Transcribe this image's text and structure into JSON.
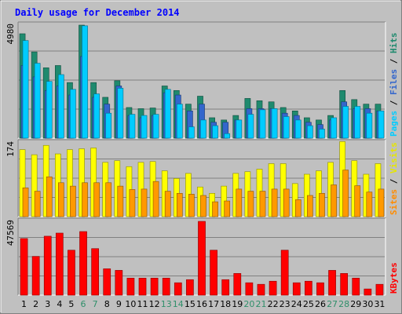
{
  "chart_data": {
    "type": "bar",
    "title": "Daily usage for December 2014",
    "categories": [
      "1",
      "2",
      "3",
      "4",
      "5",
      "6",
      "7",
      "8",
      "9",
      "10",
      "11",
      "12",
      "13",
      "14",
      "15",
      "16",
      "17",
      "18",
      "19",
      "20",
      "21",
      "22",
      "23",
      "24",
      "25",
      "26",
      "27",
      "28",
      "29",
      "30",
      "31"
    ],
    "weekend_days": [
      "6",
      "7",
      "13",
      "14",
      "20",
      "21",
      "27",
      "28"
    ],
    "panels": [
      {
        "ymax_label": "4980",
        "ymax": 4980,
        "legend": [
          {
            "text": "Pages",
            "color": "#00ccff"
          },
          {
            "text": " / ",
            "color": "#000000"
          },
          {
            "text": "Files",
            "color": "#3366cc"
          },
          {
            "text": " / ",
            "color": "#000000"
          },
          {
            "text": "Hits",
            "color": "#1f8a6e"
          }
        ],
        "series": [
          {
            "name": "Hits",
            "color": "#1f8a6e",
            "values": [
              4600,
              3800,
              3100,
              3200,
              2450,
              4980,
              2450,
              1800,
              2530,
              1350,
              1300,
              1330,
              2300,
              2100,
              1500,
              1850,
              900,
              800,
              1000,
              1750,
              1650,
              1600,
              1350,
              1200,
              900,
              800,
              1000,
              2100,
              1700,
              1500,
              1500
            ]
          },
          {
            "name": "Files",
            "color": "#3366cc",
            "values": [
              3200,
              2700,
              2100,
              2300,
              1900,
              3600,
              1800,
              1500,
              2300,
              1000,
              900,
              1000,
              2000,
              1900,
              1200,
              1500,
              700,
              700,
              800,
              1300,
              1300,
              1300,
              1100,
              1000,
              700,
              600,
              800,
              1600,
              1300,
              1300,
              1200
            ]
          },
          {
            "name": "Pages",
            "color": "#00ccff",
            "values": [
              4300,
              3300,
              2500,
              2800,
              2150,
              4950,
              1950,
              1100,
              2200,
              1050,
              1000,
              1050,
              2150,
              1500,
              500,
              800,
              550,
              200,
              800,
              1050,
              1250,
              1300,
              950,
              800,
              550,
              400,
              900,
              1400,
              1400,
              1100,
              1200
            ]
          }
        ]
      },
      {
        "ymax_label": "174",
        "ymax": 174,
        "legend": [
          {
            "text": "Sites",
            "color": "#ff8c00"
          },
          {
            "text": " / ",
            "color": "#000000"
          },
          {
            "text": "Visits",
            "color": "#e6e600"
          }
        ],
        "series": [
          {
            "name": "Visits",
            "color": "#ffff00",
            "values": [
              158,
              146,
              168,
              148,
              158,
              160,
              162,
              128,
              132,
              118,
              128,
              130,
              108,
              90,
              102,
              70,
              55,
              72,
              102,
              106,
              112,
              125,
              125,
              78,
              100,
              108,
              128,
              177,
              132,
              100,
              125
            ]
          },
          {
            "name": "Sites",
            "color": "#ff9900",
            "values": [
              68,
              60,
              94,
              80,
              72,
              80,
              80,
              80,
              72,
              64,
              65,
              83,
              60,
              55,
              53,
              50,
              35,
              37,
              65,
              60,
              60,
              65,
              65,
              40,
              50,
              55,
              75,
              110,
              73,
              58,
              65
            ]
          }
        ]
      },
      {
        "ymax_label": "47569",
        "ymax": 47569,
        "legend": [
          {
            "text": "KBytes",
            "color": "#ff0000"
          }
        ],
        "series": [
          {
            "name": "KBytes",
            "color": "#ff0000",
            "values": [
              36500,
              25000,
              38000,
              40000,
              29000,
              41000,
              30000,
              17000,
              16000,
              11000,
              11000,
              11000,
              11000,
              8000,
              10000,
              47569,
              29000,
              10000,
              14000,
              8000,
              7000,
              9000,
              29000,
              8000,
              9000,
              8000,
              16000,
              14000,
              11000,
              4000,
              7000
            ]
          }
        ]
      }
    ]
  }
}
